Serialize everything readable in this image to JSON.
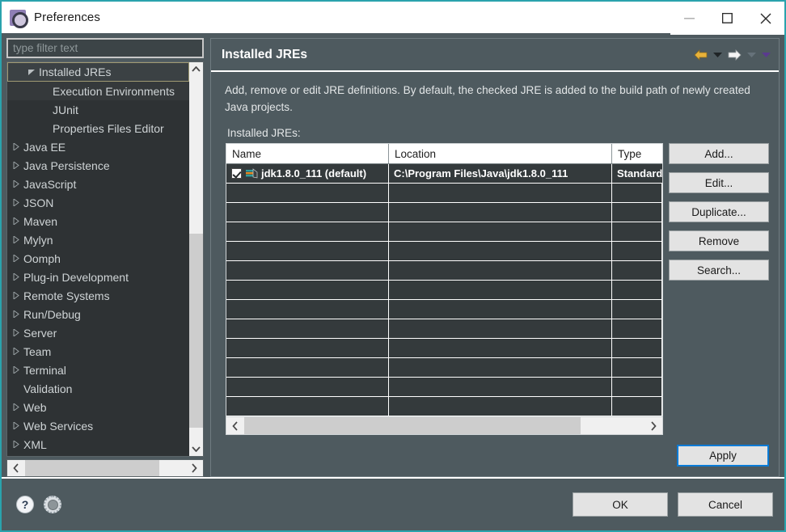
{
  "window": {
    "title": "Preferences",
    "app_icon": "gear-icon",
    "controls": {
      "minimize": "minimize-icon",
      "maximize": "maximize-icon",
      "close": "close-icon"
    }
  },
  "sidebar": {
    "filter": {
      "placeholder": "type filter text",
      "value": ""
    },
    "items": [
      {
        "label": "Installed JREs",
        "indent": 1,
        "expandable": true,
        "expanded": true,
        "selected": true
      },
      {
        "label": "Execution Environments",
        "indent": 2,
        "expandable": false,
        "highlight": true
      },
      {
        "label": "JUnit",
        "indent": 2,
        "expandable": false
      },
      {
        "label": "Properties Files Editor",
        "indent": 2,
        "expandable": false
      },
      {
        "label": "Java EE",
        "indent": 0,
        "expandable": true
      },
      {
        "label": "Java Persistence",
        "indent": 0,
        "expandable": true
      },
      {
        "label": "JavaScript",
        "indent": 0,
        "expandable": true
      },
      {
        "label": "JSON",
        "indent": 0,
        "expandable": true
      },
      {
        "label": "Maven",
        "indent": 0,
        "expandable": true
      },
      {
        "label": "Mylyn",
        "indent": 0,
        "expandable": true
      },
      {
        "label": "Oomph",
        "indent": 0,
        "expandable": true
      },
      {
        "label": "Plug-in Development",
        "indent": 0,
        "expandable": true
      },
      {
        "label": "Remote Systems",
        "indent": 0,
        "expandable": true
      },
      {
        "label": "Run/Debug",
        "indent": 0,
        "expandable": true
      },
      {
        "label": "Server",
        "indent": 0,
        "expandable": true
      },
      {
        "label": "Team",
        "indent": 0,
        "expandable": true
      },
      {
        "label": "Terminal",
        "indent": 0,
        "expandable": true
      },
      {
        "label": "Validation",
        "indent": 0,
        "expandable": false
      },
      {
        "label": "Web",
        "indent": 0,
        "expandable": true
      },
      {
        "label": "Web Services",
        "indent": 0,
        "expandable": true
      },
      {
        "label": "XML",
        "indent": 0,
        "expandable": true
      }
    ]
  },
  "panel": {
    "title": "Installed JREs",
    "description": "Add, remove or edit JRE definitions. By default, the checked JRE is added to the build path of newly created Java projects.",
    "table_label": "Installed JREs:",
    "nav": {
      "back": "back-arrow-icon",
      "back_menu": "chevron-down-icon",
      "forward": "forward-arrow-icon",
      "forward_menu": "chevron-down-icon",
      "view_menu": "chevron-down-icon"
    }
  },
  "table": {
    "columns": [
      "Name",
      "Location",
      "Type"
    ],
    "rows": [
      {
        "checked": true,
        "icon": "jre-icon",
        "name": "jdk1.8.0_111 (default)",
        "location": "C:\\Program Files\\Java\\jdk1.8.0_111",
        "type": "Standard"
      }
    ],
    "empty_row_count": 12
  },
  "buttons": {
    "add": "Add...",
    "edit": "Edit...",
    "duplicate": "Duplicate...",
    "remove": "Remove",
    "search": "Search...",
    "apply": "Apply",
    "ok": "OK",
    "cancel": "Cancel"
  },
  "footer": {
    "help_icon": "help-icon",
    "settings_icon": "gear-icon"
  },
  "colors": {
    "accent_border": "#2aa3ad",
    "panel_bg": "#4e5a5f",
    "tree_bg": "#2e3234",
    "focus_blue": "#0a7bd6",
    "back_arrow": "#e8b23a",
    "forward_arrow": "#ffffff",
    "selection_outline": "#a09a73"
  }
}
